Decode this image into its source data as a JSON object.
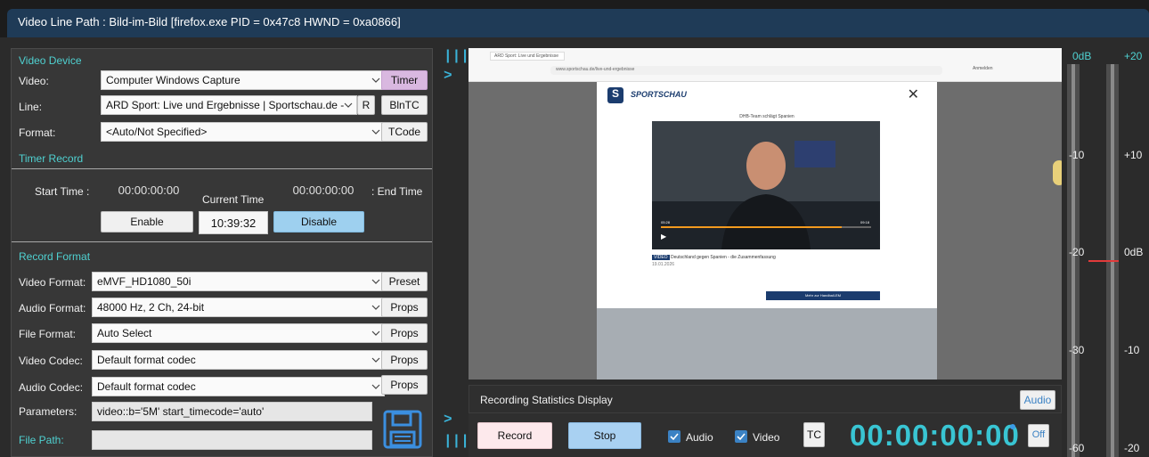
{
  "window": {
    "title": "Video Line Path : Bild-im-Bild [firefox.exe PID = 0x47c8 HWND = 0xa0866]"
  },
  "video_device": {
    "section": "Video Device",
    "video_label": "Video:",
    "video_value": "Computer Windows Capture",
    "timer_button": "Timer",
    "line_label": "Line:",
    "line_value": "ARD Sport: Live und Ergebnisse | Sportschau.de -",
    "r_button": "R",
    "blntc_button": "BlnTC",
    "format_label": "Format:",
    "format_value": "<Auto/Not Specified>",
    "tcode_button": "TCode"
  },
  "timer_record": {
    "section": "Timer Record",
    "start_label": "Start Time :",
    "start_value": "00:00:00:00",
    "current_label": "Current Time",
    "current_value": "10:39:32",
    "end_value": "00:00:00:00",
    "end_label": ": End Time",
    "enable_button": "Enable",
    "disable_button": "Disable"
  },
  "record_format": {
    "section": "Record Format",
    "rows": [
      {
        "label": "Video Format:",
        "value": "eMVF_HD1080_50i",
        "button": "Preset"
      },
      {
        "label": "Audio Format:",
        "value": "48000 Hz, 2 Ch, 24-bit",
        "button": "Props"
      },
      {
        "label": "File Format:",
        "value": "Auto Select",
        "button": "Props"
      },
      {
        "label": "Video Codec:",
        "value": "Default format codec",
        "button": "Props"
      },
      {
        "label": "Audio Codec:",
        "value": "Default format codec",
        "button": "Props"
      }
    ],
    "parameters_label": "Parameters:",
    "parameters_value": "video::b='5M' start_timecode='auto'",
    "file_path_label": "File Path:",
    "file_path_value": ""
  },
  "divider": {
    "top_symbol": "|||",
    "top_arrow": ">",
    "bottom_arrow": ">",
    "bottom_symbol": "|||"
  },
  "preview": {
    "tab_label": "ARD Sport: Live und Ergebnisse",
    "url": "www.sportschau.de/live-und-ergebnisse",
    "download_label": "Anmelden",
    "logo_text": "SPORTSCHAU",
    "video_caption": "DHB-Team schlägt Spanien",
    "time_elapsed": "05:28",
    "time_total": "09:18",
    "video_badge": "VIDEO",
    "video_headline": "Deutschland gegen Spanien - die Zusammenfassung",
    "video_date": "19.01.2026",
    "more_button": "Mehr zur Handball-EM"
  },
  "stats": {
    "label": "Recording Statistics Display",
    "audio_button": "Audio"
  },
  "controls": {
    "record_button": "Record",
    "stop_button": "Stop",
    "audio_check": "Audio",
    "video_check": "Video",
    "tc_button": "TC",
    "timecode": "00:00:00:00",
    "off_button": "Off"
  },
  "meter": {
    "left_labels": [
      "0dB",
      "-10",
      "-20",
      "-30",
      "-60"
    ],
    "right_labels": [
      "+20",
      "+10",
      "0dB",
      "-10",
      "-20"
    ],
    "accent_color": "#4fd1d1",
    "peak_color": "#e23b3b"
  }
}
